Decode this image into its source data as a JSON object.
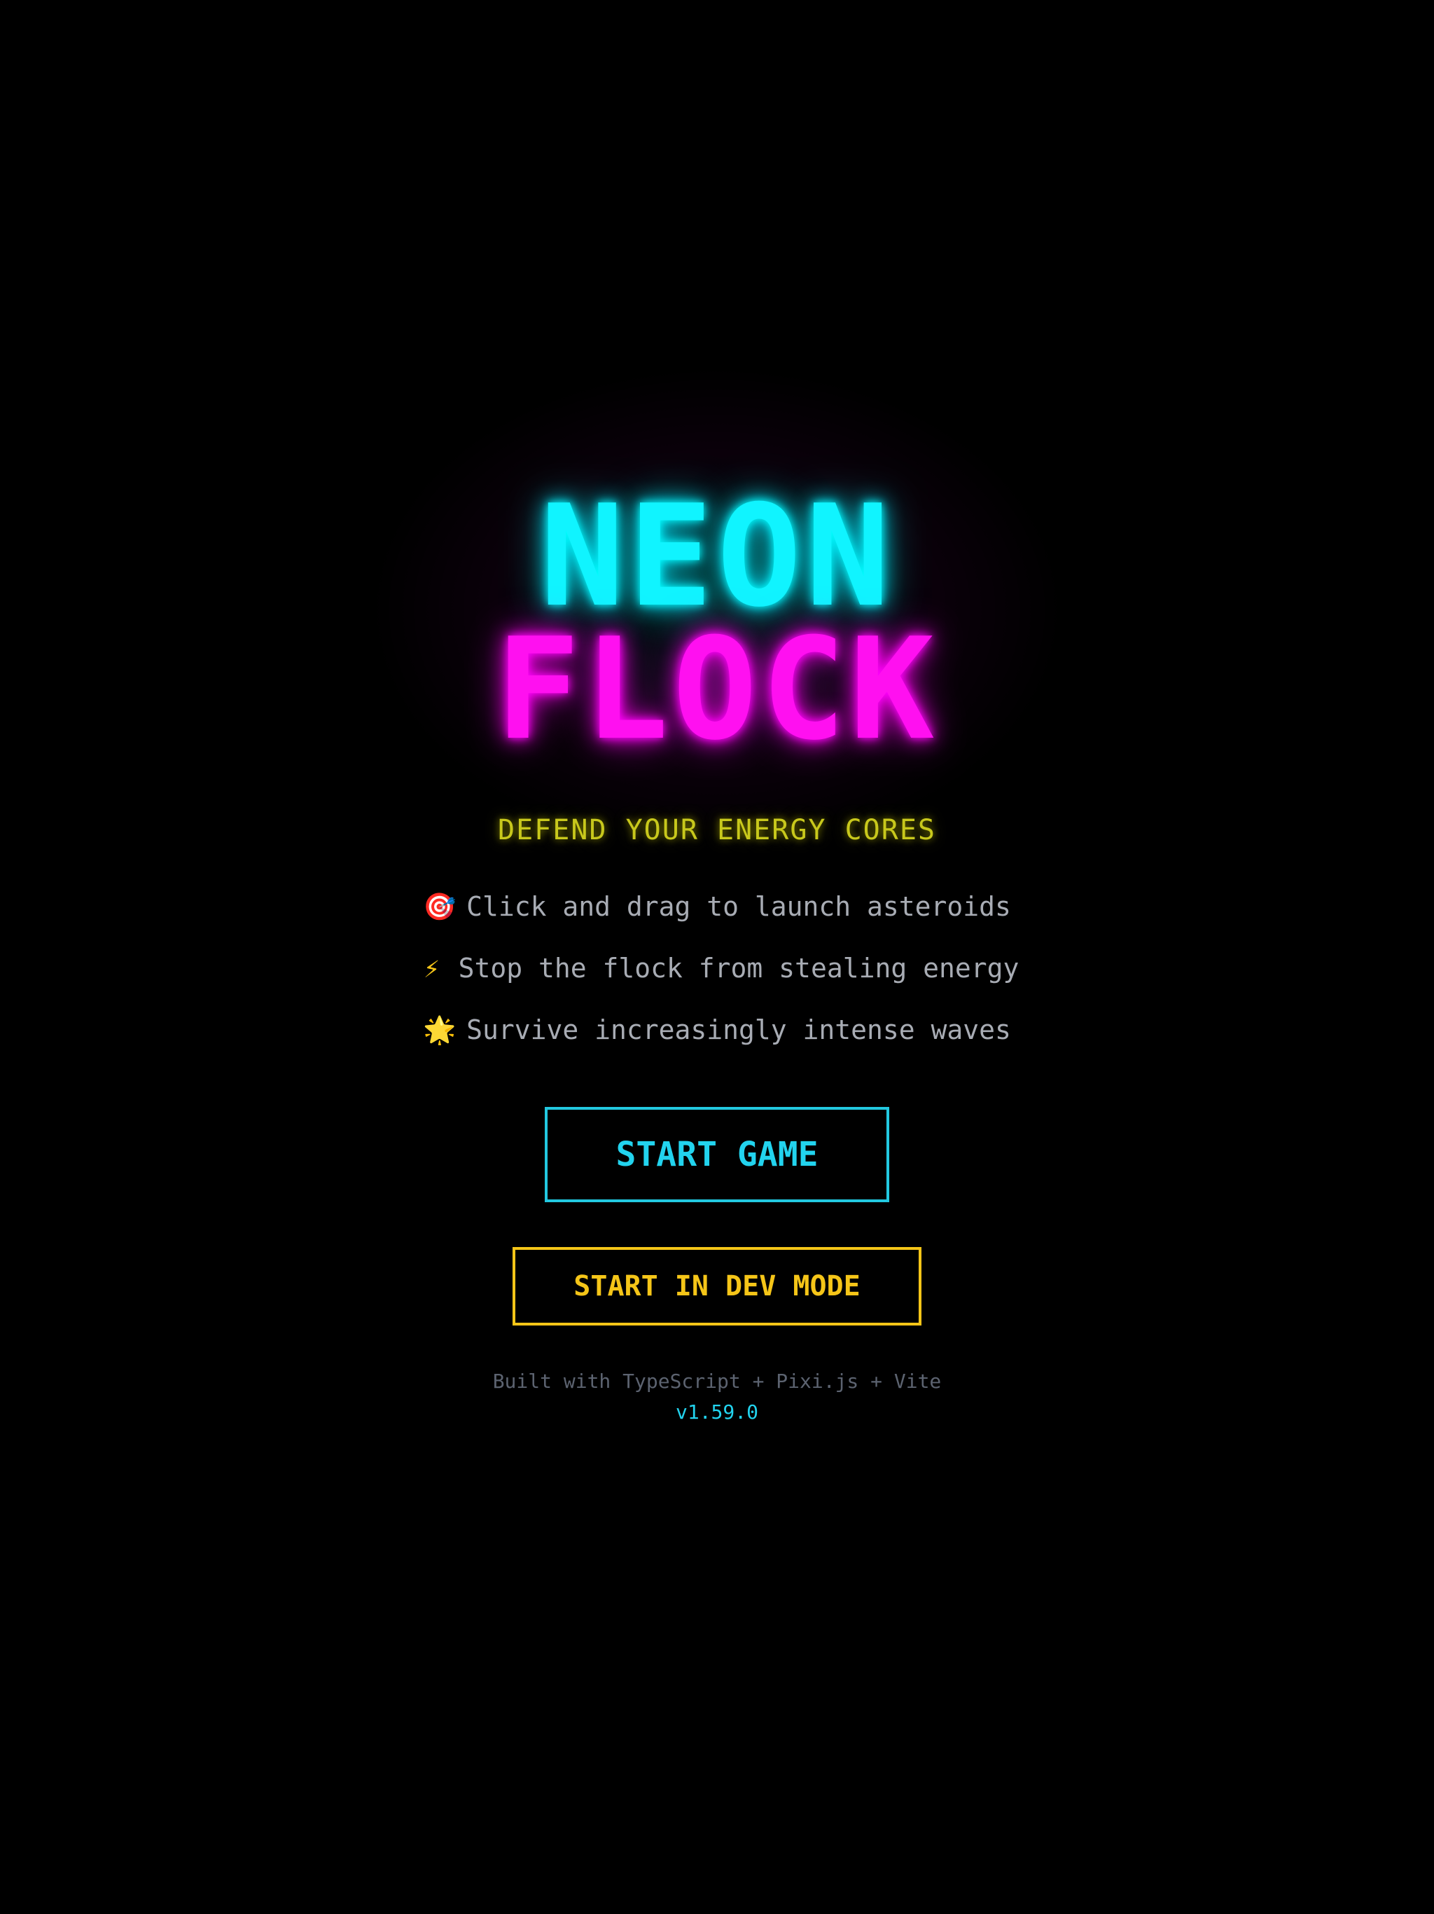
{
  "title": {
    "line1": "NEON",
    "line2": "FLOCK"
  },
  "subtitle": "DEFEND YOUR ENERGY CORES",
  "instructions": [
    {
      "icon": "target-icon",
      "glyph": "🎯",
      "text": "Click and drag to launch asteroids"
    },
    {
      "icon": "lightning-icon",
      "glyph": "⚡",
      "text": "Stop the flock from stealing energy"
    },
    {
      "icon": "star-icon",
      "glyph": "🌟",
      "text": "Survive increasingly intense waves"
    }
  ],
  "buttons": {
    "start_label": "START GAME",
    "dev_label": "START IN DEV MODE"
  },
  "footer": {
    "built_with": "Built with TypeScript + Pixi.js + Vite",
    "version": "v1.59.0"
  },
  "colors": {
    "background": "#000000",
    "neon_cyan": "#10f4ff",
    "neon_magenta": "#ff10f0",
    "subtitle_yellow": "#c8c81c",
    "start_button": "#22d3ee",
    "dev_button": "#f5c518",
    "instruction_text": "#a8acb4",
    "footer_text": "#5c6370"
  }
}
